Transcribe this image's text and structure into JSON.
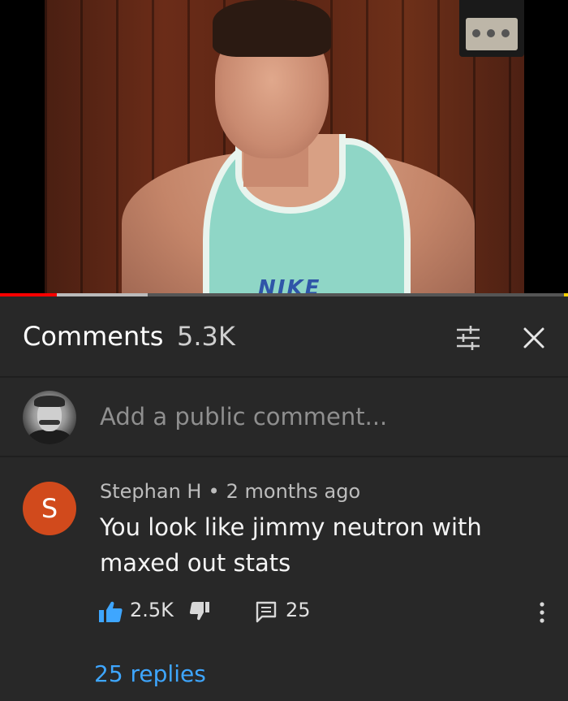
{
  "video": {
    "shirt_logo": "NIKE",
    "progress_played": 0.1,
    "progress_buffered": 0.26
  },
  "comments_header": {
    "title": "Comments",
    "count": "5.3K",
    "icons": [
      "filter-sort-icon",
      "close-icon"
    ]
  },
  "add_comment": {
    "placeholder": "Add a public comment..."
  },
  "comment": {
    "avatar_letter": "S",
    "author": "Stephan H",
    "separator": "•",
    "time": "2 months ago",
    "text": "You look like jimmy neutron with maxed out stats",
    "likes": "2.5K",
    "reply_count": "25",
    "replies_link": "25 replies"
  },
  "colors": {
    "background": "#282828",
    "avatar": "#d14a1c",
    "link": "#3ea6ff",
    "like_active": "#3ea6ff",
    "progress_played": "#ff0000"
  }
}
